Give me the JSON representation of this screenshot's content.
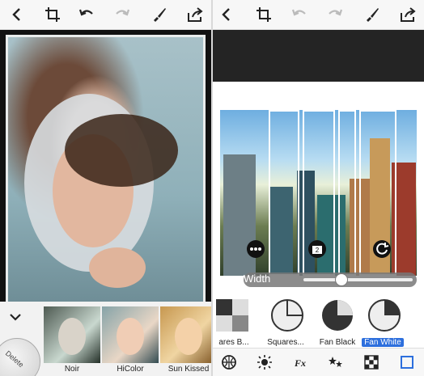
{
  "left": {
    "filters": [
      {
        "label": "Noir"
      },
      {
        "label": "HiColor"
      },
      {
        "label": "Sun Kissed"
      }
    ],
    "delete_badge": "Delete"
  },
  "right": {
    "width_label": "Width",
    "width_value_fraction": 0.35,
    "shapes": [
      {
        "label": "ares B..."
      },
      {
        "label": "Squares..."
      },
      {
        "label": "Fan Black"
      },
      {
        "label": "Fan White"
      }
    ],
    "selected_shape": "Fan White",
    "bottom_tools": [
      "globe-icon",
      "brightness-icon",
      "fx-icon",
      "stars-icon",
      "checker-icon",
      "frame-icon"
    ]
  },
  "colors": {
    "accent": "#2d6fdd",
    "toolbar_bg": "#f7f7f7",
    "dark_strip": "#242424"
  }
}
